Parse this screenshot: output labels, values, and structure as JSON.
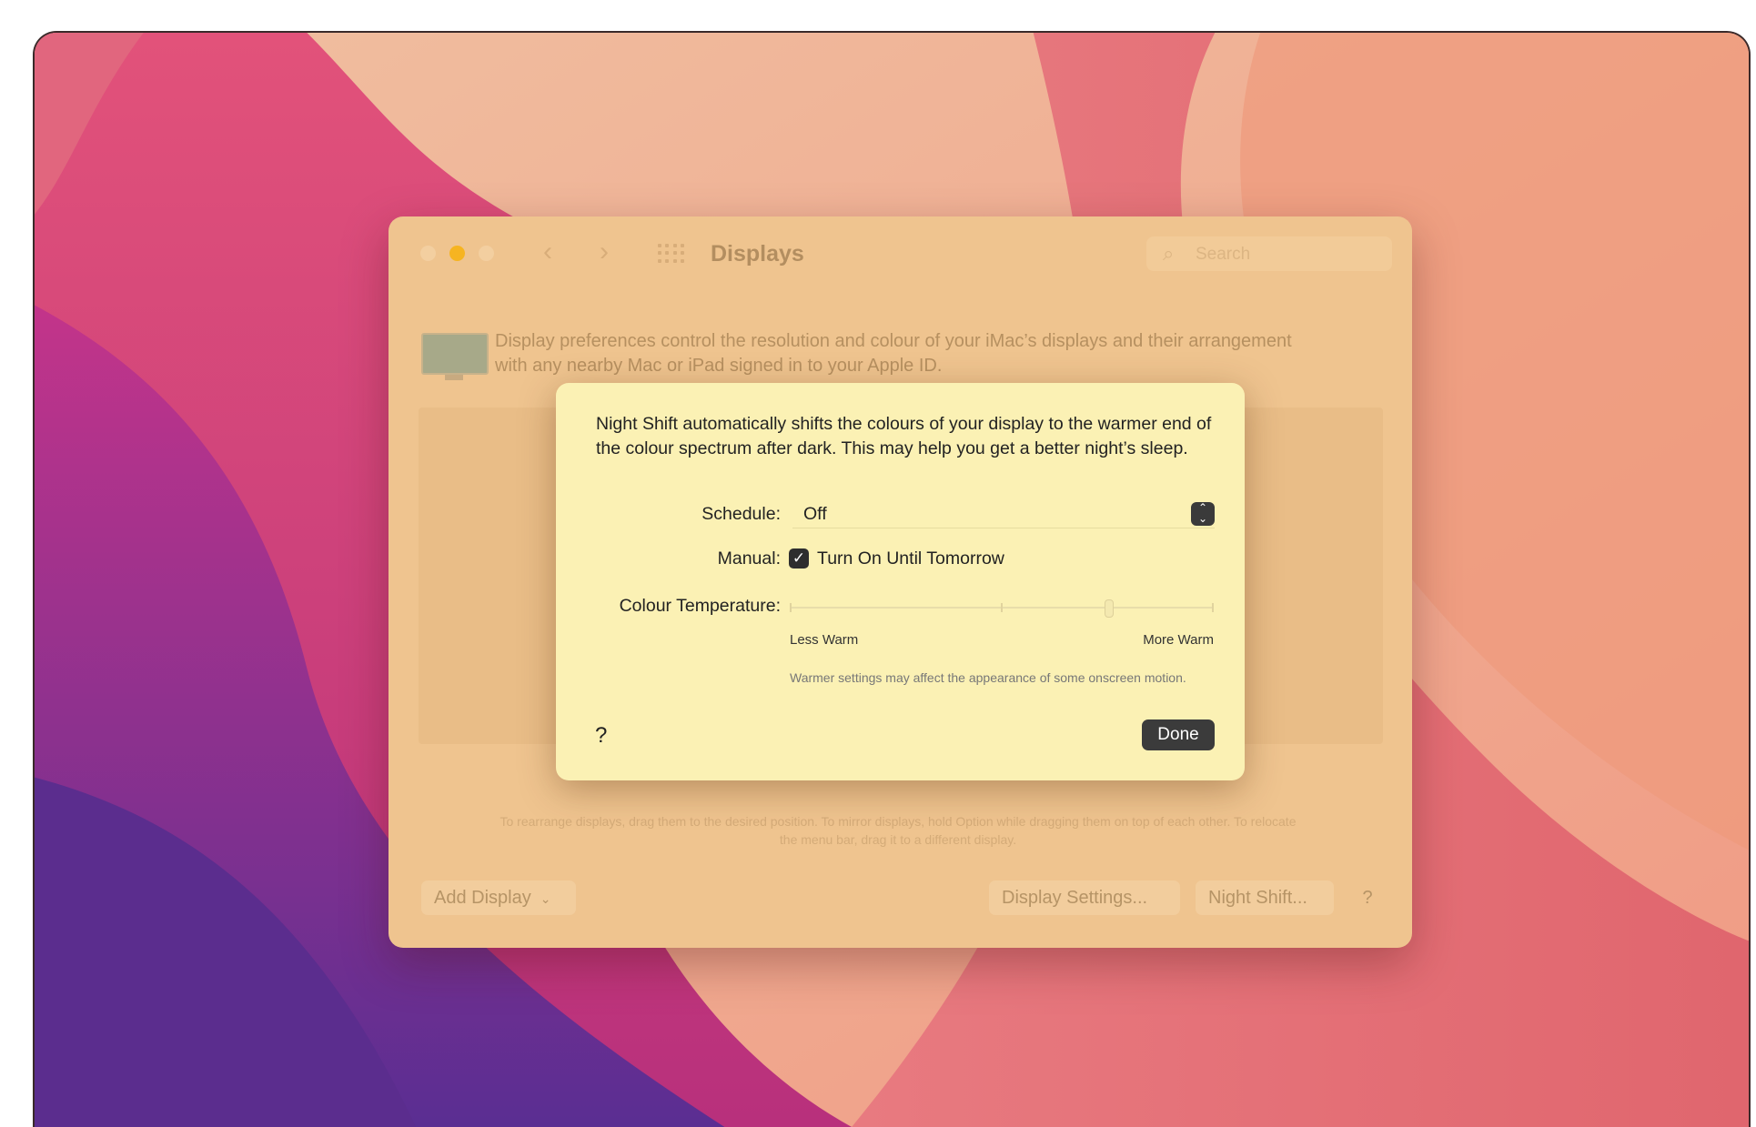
{
  "window": {
    "title": "Displays",
    "search_placeholder": "Search",
    "description": "Display preferences control the resolution and colour of your iMac’s displays and their arrangement with any nearby Mac or iPad signed in to your Apple ID.",
    "arrange_hint": "To rearrange displays, drag them to the desired position. To mirror displays, hold Option while dragging them on top of each other. To relocate the menu bar, drag it to a different display.",
    "add_display_label": "Add Display",
    "display_settings_label": "Display Settings...",
    "night_shift_label": "Night Shift...",
    "help_label": "?"
  },
  "night_shift": {
    "description": "Night Shift automatically shifts the colours of your display to the warmer end of the colour spectrum after dark. This may help you get a better night’s sleep.",
    "schedule_label": "Schedule:",
    "schedule_value": "Off",
    "manual_label": "Manual:",
    "manual_option": "Turn On Until Tomorrow",
    "manual_checked": true,
    "colour_temp_label": "Colour Temperature:",
    "less_warm": "Less Warm",
    "more_warm": "More Warm",
    "colour_temp_level": 0.75,
    "warmer_note": "Warmer settings may affect the appearance of some onscreen motion.",
    "help_label": "?",
    "done_label": "Done"
  },
  "colors": {
    "sheet_background": "#fbf1b4",
    "window_tint": "#efc48f",
    "done_button": "#3b3b3b"
  }
}
